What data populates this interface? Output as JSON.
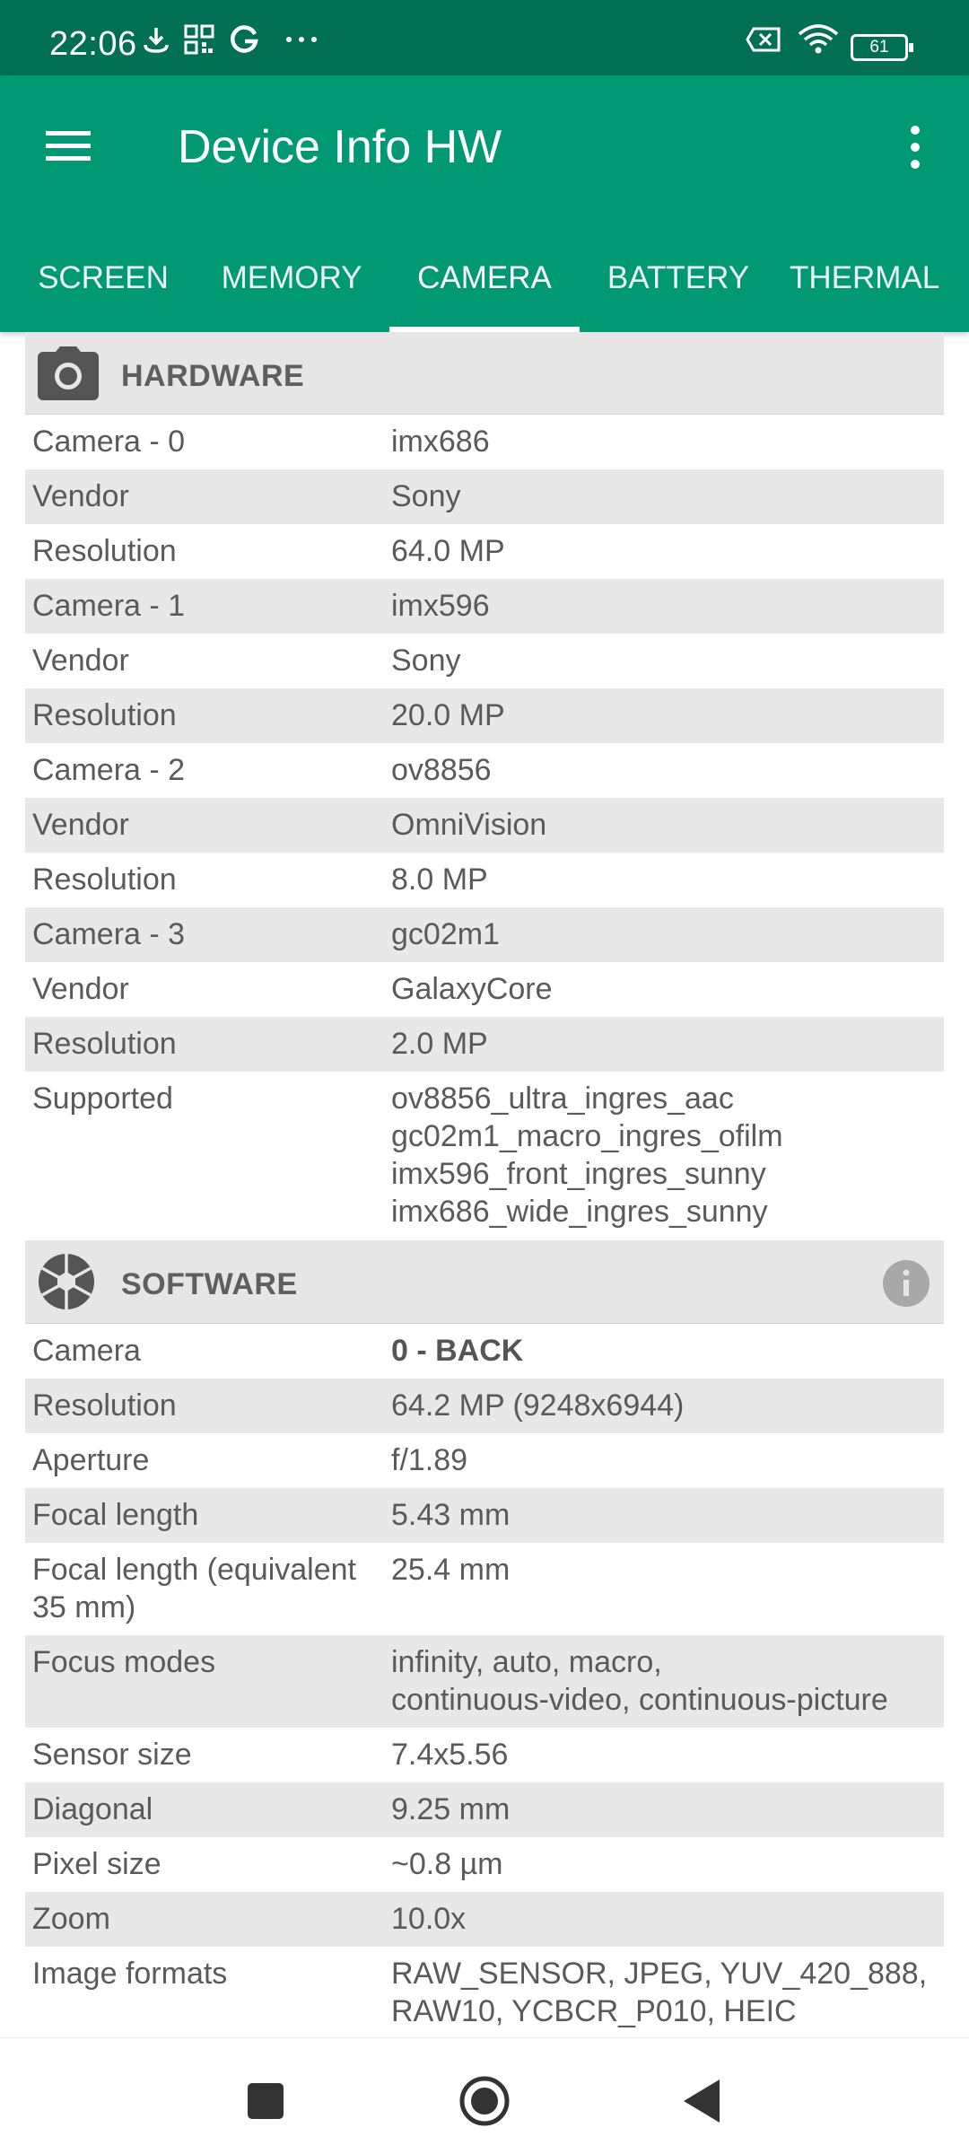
{
  "status_bar": {
    "time": "22:06",
    "battery_level": "61",
    "icons": [
      "download-icon",
      "qr-icon",
      "google-icon",
      "more-dots-icon",
      "no-sim-icon",
      "wifi-icon",
      "battery-icon"
    ]
  },
  "app_bar": {
    "title": "Device Info HW"
  },
  "tabs": [
    {
      "label": "SCREEN",
      "active": false
    },
    {
      "label": "MEMORY",
      "active": false
    },
    {
      "label": "CAMERA",
      "active": true
    },
    {
      "label": "BATTERY",
      "active": false
    },
    {
      "label": "THERMAL",
      "active": false
    }
  ],
  "hardware": {
    "title": "HARDWARE",
    "icon": "camera-icon",
    "rows": [
      {
        "key": "Camera - 0",
        "value": "imx686"
      },
      {
        "key": "Vendor",
        "value": "Sony"
      },
      {
        "key": "Resolution",
        "value": "64.0 MP"
      },
      {
        "key": "Camera - 1",
        "value": "imx596"
      },
      {
        "key": "Vendor",
        "value": "Sony"
      },
      {
        "key": "Resolution",
        "value": "20.0 MP"
      },
      {
        "key": "Camera - 2",
        "value": "ov8856"
      },
      {
        "key": "Vendor",
        "value": "OmniVision"
      },
      {
        "key": "Resolution",
        "value": "8.0 MP"
      },
      {
        "key": "Camera - 3",
        "value": "gc02m1"
      },
      {
        "key": "Vendor",
        "value": "GalaxyCore"
      },
      {
        "key": "Resolution",
        "value": "2.0 MP"
      }
    ],
    "supported": {
      "key": "Supported",
      "values": [
        "ov8856_ultra_ingres_aac",
        "gc02m1_macro_ingres_ofilm",
        "imx596_front_ingres_sunny",
        "imx686_wide_ingres_sunny"
      ]
    }
  },
  "software": {
    "title": "SOFTWARE",
    "icon": "aperture-icon",
    "rows": [
      {
        "key": "Camera",
        "value": "0 - BACK"
      },
      {
        "key": "Resolution",
        "value": "64.2 MP (9248x6944)"
      },
      {
        "key": "Aperture",
        "value": "f/1.89"
      },
      {
        "key": "Focal length",
        "value": "5.43 mm"
      },
      {
        "key_lines": [
          "Focal length (equivalent",
          "35 mm)"
        ],
        "value": "25.4 mm"
      },
      {
        "key": "Focus modes",
        "value_lines": [
          "infinity, auto, macro,",
          "continuous-video, continuous-picture"
        ]
      },
      {
        "key": "Sensor size",
        "value": "7.4x5.56"
      },
      {
        "key": "Diagonal",
        "value": "9.25 mm"
      },
      {
        "key": "Pixel size",
        "value": "~0.8 µm"
      },
      {
        "key": "Zoom",
        "value": "10.0x"
      },
      {
        "key": "Image formats",
        "value_lines": [
          "RAW_SENSOR, JPEG, YUV_420_888,",
          "RAW10, YCBCR_P010, HEIC"
        ]
      }
    ]
  },
  "nav_bar": {
    "buttons": [
      "recents-square-icon",
      "home-circle-icon",
      "back-triangle-icon"
    ]
  },
  "colors": {
    "status_bar": "#016f54",
    "app_bar": "#019874",
    "row_alt": "#e8e8e8",
    "section_header": "#e6e6e6"
  }
}
